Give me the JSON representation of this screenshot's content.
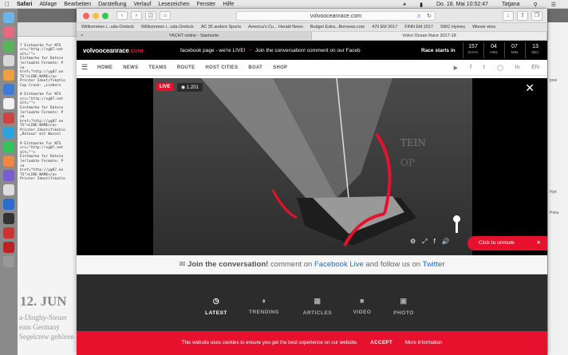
{
  "menubar": {
    "app": "Safari",
    "items": [
      "Ablage",
      "Bearbeiten",
      "Darstellung",
      "Verlauf",
      "Lesezeichen",
      "Fenster",
      "Hilfe"
    ],
    "clock": "Do. 18. Mai 10:52:47",
    "user": "Tatjana"
  },
  "browser": {
    "url": "volvooceanrace.com",
    "favorites": [
      "Willkommen i...uda-Oreleck",
      "Willkommen i...uda-Oreleck",
      "AC 35 andere Sports",
      "America's Cu... Herald News",
      "Budget Extra...Bernews.com",
      "470 EM 2017",
      "FINN EM 2017",
      "SWC Hyères",
      "Wieser wins"
    ],
    "tabs": [
      "YACHT online - Startseite",
      "Volvo Ocean Race 2017-18"
    ]
  },
  "site": {
    "logo_main": "volvooceanrace",
    "logo_dom": ".com",
    "ticker_a": "facebook page - we're LIVE!",
    "ticker_b": "Join the conversation! comment on our Faceb",
    "race_label": "Race starts in",
    "countdown": [
      {
        "value": "157",
        "unit": "DAYS"
      },
      {
        "value": "04",
        "unit": "HRS"
      },
      {
        "value": "07",
        "unit": "MIN"
      },
      {
        "value": "13",
        "unit": "SEC"
      }
    ],
    "nav": [
      "HOME",
      "NEWS",
      "TEAMS",
      "ROUTE",
      "HOST CITIES",
      "BOAT",
      "SHOP"
    ],
    "lang": "EN",
    "video": {
      "live": "LIVE",
      "views": "1.201",
      "unmute": "Click  to unmute"
    },
    "join": {
      "bold": "Join the conversation!",
      "t1": " comment on ",
      "l1": "Facebook Live",
      "t2": " and follow us on ",
      "l2": "Twitter"
    },
    "feed": [
      "LATEST",
      "TRENDING",
      "ARTICLES",
      "VIDEO",
      "PHOTO"
    ],
    "cookie": {
      "text": "This website uses cookies to ensure you get the best experience on our website.",
      "accept": "ACCEPT",
      "more": "More information"
    }
  },
  "bg_left": {
    "big": "12. JUN",
    "low": "a-Dinghy-Steuer\neam Germany\nSegelcrew gehören"
  },
  "colors": {
    "accent": "#e8112d",
    "link": "#1a73c8",
    "dark": "#2c2c2c"
  }
}
